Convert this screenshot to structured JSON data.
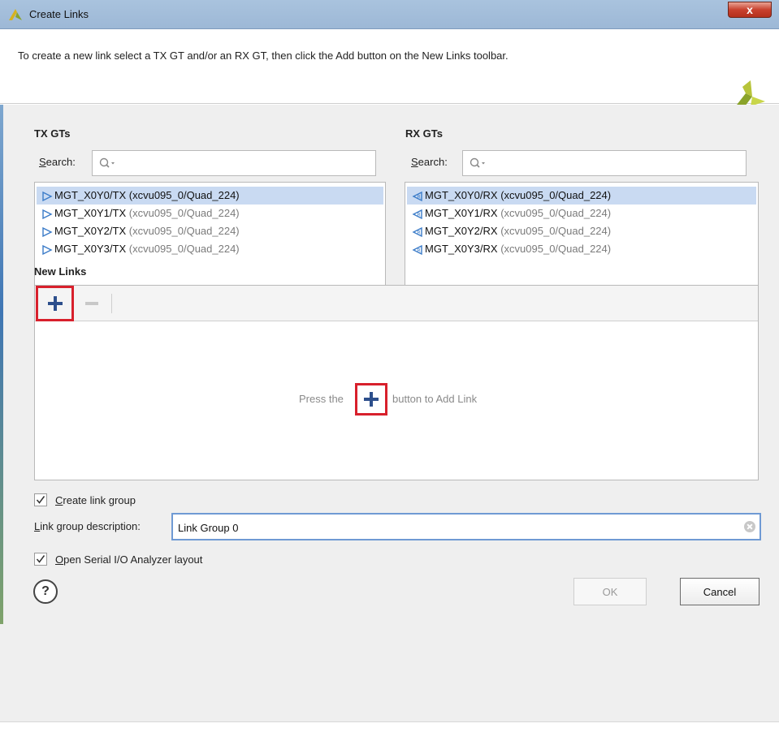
{
  "window": {
    "title": "Create Links",
    "close_glyph": "x"
  },
  "banner": {
    "instruction": "To create a new link select a TX GT and/or an RX GT, then click the Add button on the New Links toolbar."
  },
  "tx": {
    "title": "TX GTs",
    "search_label_prefix": "",
    "search_label_underlined": "S",
    "search_label_rest": "earch:",
    "items": [
      {
        "name": "MGT_X0Y0/TX",
        "location": "(xcvu095_0/Quad_224)",
        "selected": true
      },
      {
        "name": "MGT_X0Y1/TX",
        "location": "(xcvu095_0/Quad_224)",
        "selected": false
      },
      {
        "name": "MGT_X0Y2/TX",
        "location": "(xcvu095_0/Quad_224)",
        "selected": false
      },
      {
        "name": "MGT_X0Y3/TX",
        "location": "(xcvu095_0/Quad_224)",
        "selected": false
      }
    ]
  },
  "rx": {
    "title": "RX GTs",
    "search_label_underlined": "S",
    "search_label_rest": "earch:",
    "items": [
      {
        "name": "MGT_X0Y0/RX",
        "location": "(xcvu095_0/Quad_224)",
        "selected": true
      },
      {
        "name": "MGT_X0Y1/RX",
        "location": "(xcvu095_0/Quad_224)",
        "selected": false
      },
      {
        "name": "MGT_X0Y2/RX",
        "location": "(xcvu095_0/Quad_224)",
        "selected": false
      },
      {
        "name": "MGT_X0Y3/RX",
        "location": "(xcvu095_0/Quad_224)",
        "selected": false
      }
    ]
  },
  "new_links": {
    "title": "New Links",
    "hint_before": "Press the",
    "hint_after": "button to Add Link"
  },
  "options": {
    "create_group_underlined": "C",
    "create_group_rest": "reate link group",
    "create_group_checked": true,
    "desc_label_underlined": "L",
    "desc_label_rest": "ink group description:",
    "desc_value": "Link Group 0",
    "open_layout_underlined": "O",
    "open_layout_rest": "pen Serial I/O Analyzer layout",
    "open_layout_checked": true
  },
  "footer": {
    "help_glyph": "?",
    "ok_label": "OK",
    "cancel_label": "Cancel"
  },
  "colors": {
    "selection": "#c9daf2",
    "highlight_box": "#d8202c",
    "add_icon": "#2d4f8c",
    "gt_icon": "#3a7bc8",
    "focus_border": "#6f9ad4"
  }
}
